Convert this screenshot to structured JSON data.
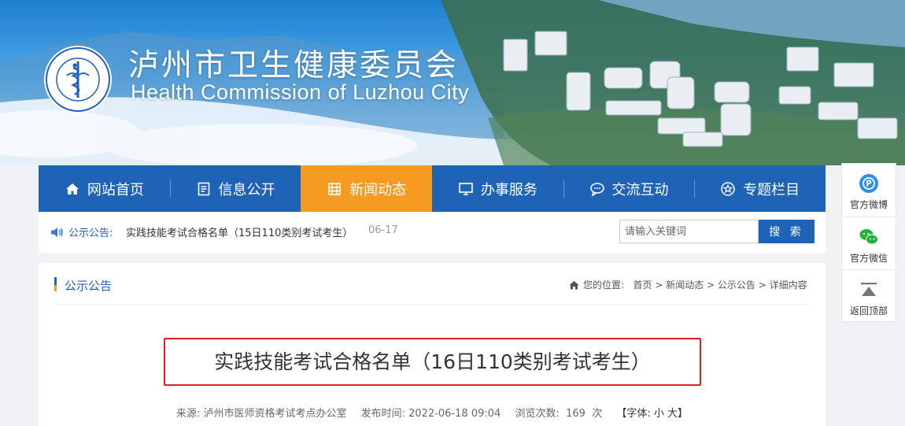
{
  "header": {
    "site_title": "泸州市卫生健康委员会",
    "site_subtitle": "Health Commission of Luzhou City",
    "logo_ring_text": "泸州市卫生健康委员会",
    "logo_ring_text_en": "Health Commission of Luzhou City"
  },
  "nav": {
    "items": [
      {
        "label": "网站首页",
        "icon": "home-icon"
      },
      {
        "label": "信息公开",
        "icon": "document-icon"
      },
      {
        "label": "新闻动态",
        "icon": "building-icon",
        "active": true
      },
      {
        "label": "办事服务",
        "icon": "monitor-icon"
      },
      {
        "label": "交流互动",
        "icon": "chat-icon"
      },
      {
        "label": "专题栏目",
        "icon": "star-icon"
      }
    ],
    "active_color": "#f59b22",
    "bar_color": "#1f63b7"
  },
  "notice": {
    "label": "公示公告:",
    "text": "实践技能考试合格名单（15日110类别考试考生）",
    "date": "06-17"
  },
  "search": {
    "placeholder": "请输入关键词",
    "button_label": "搜 索"
  },
  "section": {
    "title": "公示公告",
    "breadcrumb_prefix": "您的位置:",
    "breadcrumb": [
      "首页",
      "新闻动态",
      "公示公告",
      "详细内容"
    ]
  },
  "article": {
    "title": "实践技能考试合格名单（16日110类别考试考生）",
    "source_label": "来源:",
    "source": "泸州市医师资格考试考点办公室",
    "publish_label": "发布时间:",
    "publish_time": "2022-06-18 09:04",
    "views_label": "浏览次数:",
    "views": "169",
    "views_unit": "次",
    "font_label": "【字体:",
    "font_small": "小",
    "font_large": "大",
    "font_close": "】"
  },
  "side_widget": {
    "items": [
      {
        "label": "官方微博",
        "icon": "weibo-icon"
      },
      {
        "label": "官方微信",
        "icon": "wechat-icon"
      },
      {
        "label": "返回顶部",
        "icon": "back-to-top-icon"
      }
    ]
  }
}
